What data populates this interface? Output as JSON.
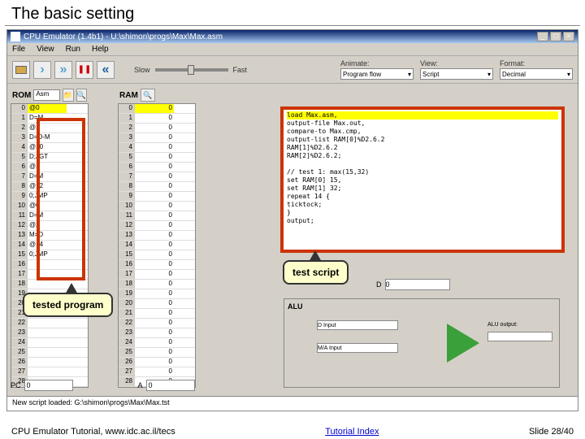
{
  "slide": {
    "title": "The basic setting"
  },
  "window": {
    "title": "CPU Emulator (1.4b1) - U:\\shimon\\progs\\Max\\Max.asm"
  },
  "menu": {
    "file": "File",
    "view": "View",
    "run": "Run",
    "help": "Help"
  },
  "toolbar": {
    "slow": "Slow",
    "fast": "Fast",
    "animate_lbl": "Animate:",
    "animate_val": "Program flow",
    "view_lbl": "View:",
    "view_val": "Script",
    "format_lbl": "Format:",
    "format_val": "Decimal"
  },
  "rom": {
    "label": "ROM",
    "mode": "Asm",
    "rows": [
      {
        "i": "0",
        "v": "@0"
      },
      {
        "i": "1",
        "v": "D=M"
      },
      {
        "i": "2",
        "v": "@1"
      },
      {
        "i": "3",
        "v": "D=D-M"
      },
      {
        "i": "4",
        "v": "@10"
      },
      {
        "i": "5",
        "v": "D;JGT"
      },
      {
        "i": "6",
        "v": "@1"
      },
      {
        "i": "7",
        "v": "D=M"
      },
      {
        "i": "8",
        "v": "@12"
      },
      {
        "i": "9",
        "v": "0;JMP"
      },
      {
        "i": "10",
        "v": "@0"
      },
      {
        "i": "11",
        "v": "D=M"
      },
      {
        "i": "12",
        "v": "@2"
      },
      {
        "i": "13",
        "v": "M=D"
      },
      {
        "i": "14",
        "v": "@14"
      },
      {
        "i": "15",
        "v": "0;JMP"
      },
      {
        "i": "16",
        "v": ""
      },
      {
        "i": "17",
        "v": ""
      },
      {
        "i": "18",
        "v": ""
      },
      {
        "i": "19",
        "v": ""
      },
      {
        "i": "20",
        "v": ""
      },
      {
        "i": "21",
        "v": ""
      },
      {
        "i": "22",
        "v": ""
      },
      {
        "i": "23",
        "v": ""
      },
      {
        "i": "24",
        "v": ""
      },
      {
        "i": "25",
        "v": ""
      },
      {
        "i": "26",
        "v": ""
      },
      {
        "i": "27",
        "v": ""
      },
      {
        "i": "28",
        "v": ""
      }
    ]
  },
  "ram": {
    "label": "RAM",
    "rows": [
      {
        "i": "0",
        "v": "0"
      },
      {
        "i": "1",
        "v": "0"
      },
      {
        "i": "2",
        "v": "0"
      },
      {
        "i": "3",
        "v": "0"
      },
      {
        "i": "4",
        "v": "0"
      },
      {
        "i": "5",
        "v": "0"
      },
      {
        "i": "6",
        "v": "0"
      },
      {
        "i": "7",
        "v": "0"
      },
      {
        "i": "8",
        "v": "0"
      },
      {
        "i": "9",
        "v": "0"
      },
      {
        "i": "10",
        "v": "0"
      },
      {
        "i": "11",
        "v": "0"
      },
      {
        "i": "12",
        "v": "0"
      },
      {
        "i": "13",
        "v": "0"
      },
      {
        "i": "14",
        "v": "0"
      },
      {
        "i": "15",
        "v": "0"
      },
      {
        "i": "16",
        "v": "0"
      },
      {
        "i": "17",
        "v": "0"
      },
      {
        "i": "18",
        "v": "0"
      },
      {
        "i": "19",
        "v": "0"
      },
      {
        "i": "20",
        "v": "0"
      },
      {
        "i": "21",
        "v": "0"
      },
      {
        "i": "22",
        "v": "0"
      },
      {
        "i": "23",
        "v": "0"
      },
      {
        "i": "24",
        "v": "0"
      },
      {
        "i": "25",
        "v": "0"
      },
      {
        "i": "26",
        "v": "0"
      },
      {
        "i": "27",
        "v": "0"
      },
      {
        "i": "28",
        "v": "0"
      }
    ]
  },
  "script": {
    "lines": [
      "load Max.asm,",
      "output-file Max.out,",
      "compare-to Max.cmp,",
      "output-list RAM[0]%D2.6.2",
      "            RAM[1]%D2.6.2",
      "            RAM[2]%D2.6.2;",
      "",
      "// test 1: max(15,32)",
      "set RAM[0] 15,",
      "set RAM[1] 32;",
      "repeat 14 {",
      "  ticktock;",
      "}",
      "output;"
    ]
  },
  "callouts": {
    "tested_program": "tested program",
    "test_script": "test script"
  },
  "alu": {
    "label": "ALU",
    "d_input": "D Input",
    "m_a_input": "M/A Input",
    "alu_output": "ALU output:"
  },
  "d_reg": {
    "label": "D",
    "value": "0"
  },
  "regs": {
    "pc_label": "PC",
    "pc_value": "0",
    "a_label": "A",
    "a_value": "0"
  },
  "status": {
    "text": "New script loaded: G:\\shimon\\progs\\Max\\Max.tst"
  },
  "footer": {
    "left": "CPU Emulator Tutorial, www.idc.ac.il/tecs",
    "link": "Tutorial Index",
    "right": "Slide 28/40"
  }
}
